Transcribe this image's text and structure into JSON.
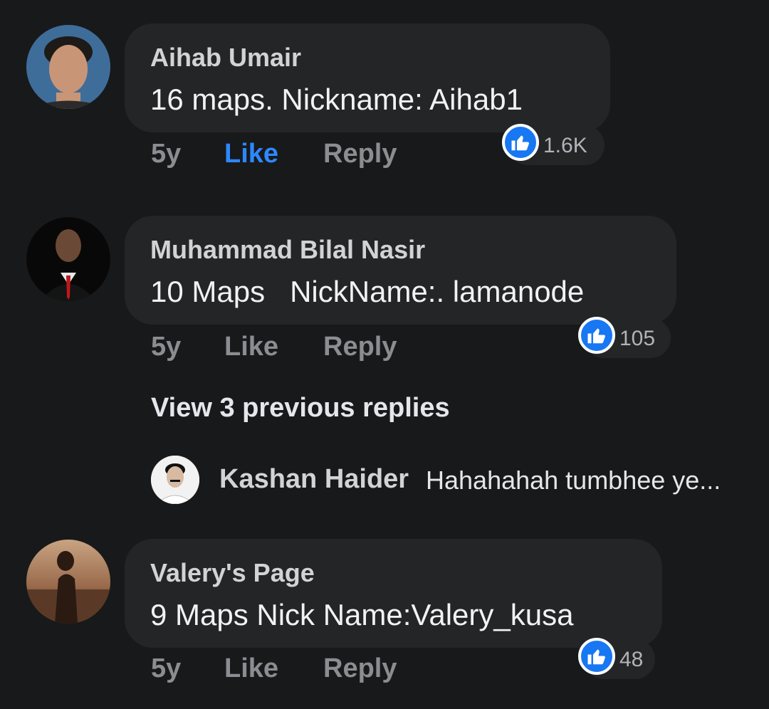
{
  "comments": [
    {
      "author": "Aihab Umair",
      "text": "16 maps. Nickname: Aihab1",
      "time": "5y",
      "like_label": "Like",
      "reply_label": "Reply",
      "reaction_icon": "thumbs-up-icon",
      "reaction_count": "1.6K",
      "liked": true
    },
    {
      "author": "Muhammad Bilal Nasir",
      "text": "10 Maps   NickName:. lamanode",
      "time": "5y",
      "like_label": "Like",
      "reply_label": "Reply",
      "reaction_icon": "thumbs-up-icon",
      "reaction_count": "105",
      "liked": false
    },
    {
      "author": "Valery's Page",
      "text": "9 Maps Nick Name:Valery_kusa",
      "time": "5y",
      "like_label": "Like",
      "reply_label": "Reply",
      "reaction_icon": "thumbs-up-icon",
      "reaction_count": "48",
      "liked": false
    }
  ],
  "replies": {
    "view_previous_label": "View 3 previous replies",
    "latest": {
      "author": "Kashan Haider",
      "text": "Hahahahah tumbhee ye..."
    }
  },
  "colors": {
    "background": "#18191a",
    "bubble": "#242526",
    "like_active": "#2d88ff",
    "like_badge": "#1877f2",
    "muted_text": "#8a8d91"
  }
}
